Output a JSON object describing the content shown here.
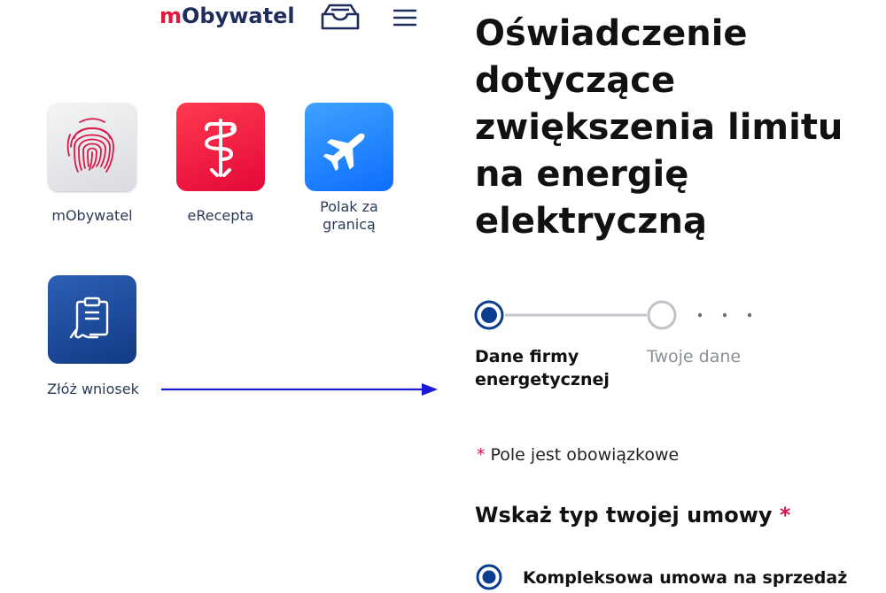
{
  "header": {
    "logo_prefix": "m",
    "logo_rest": "Obywatel",
    "icons": [
      "inbox-icon",
      "menu-icon"
    ]
  },
  "tiles": [
    {
      "label": "mObywatel",
      "icon": "fingerprint-icon"
    },
    {
      "label": "eRecepta",
      "icon": "caduceus-icon"
    },
    {
      "label_line1": "Polak za",
      "label_line2": "granicą",
      "icon": "airplane-icon"
    },
    {
      "label": "Złóż wniosek",
      "icon": "signed-document-icon"
    }
  ],
  "form": {
    "title": "Oświadczenie dotyczące zwiększenia limitu na energię elektryczną",
    "steps": [
      {
        "label": "Dane firmy energetycznej",
        "state": "active"
      },
      {
        "label": "Twoje dane",
        "state": "inactive"
      }
    ],
    "required_marker": "*",
    "required_note": "Pole jest obowiązkowe",
    "question": "Wskaż typ twojej umowy",
    "options": [
      {
        "label": "Kompleksowa umowa na sprzedaż",
        "selected": true
      }
    ]
  },
  "colors": {
    "brand_red": "#e3173e",
    "brand_navy": "#1f2d5c",
    "accent_blue": "#0b3d91",
    "required_red": "#d8134a",
    "arrow_blue": "#1a1ad6"
  }
}
